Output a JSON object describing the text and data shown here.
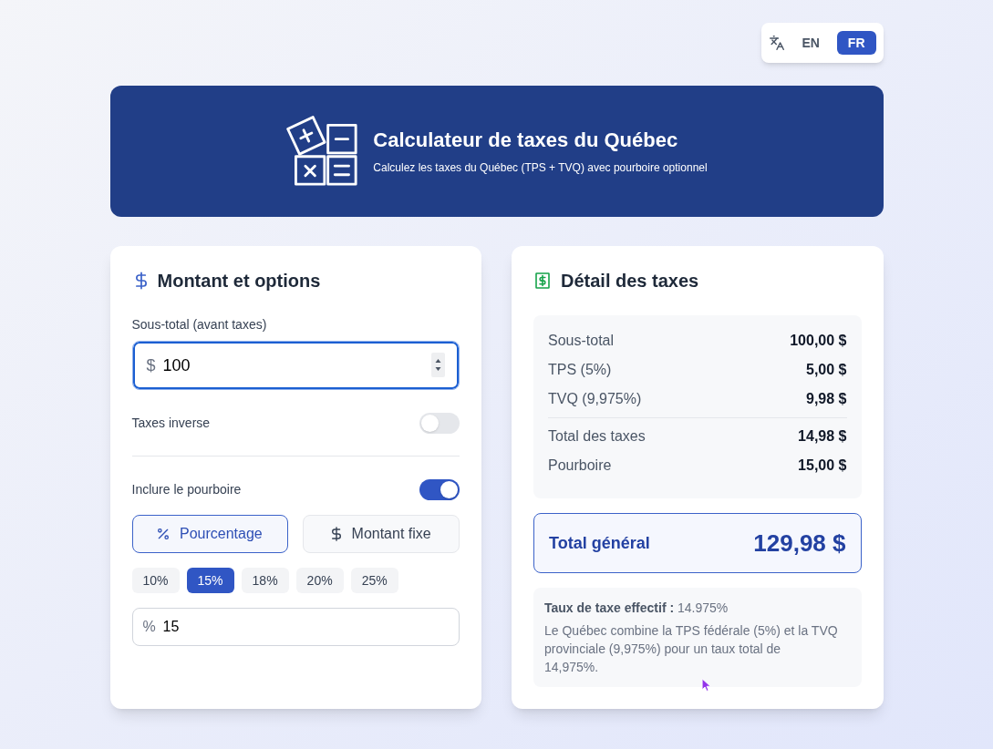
{
  "language_switcher": {
    "options": [
      {
        "label": "EN",
        "selected": false
      },
      {
        "label": "FR",
        "selected": true
      }
    ]
  },
  "header": {
    "title": "Calculateur de taxes du Québec",
    "subtitle": "Calculez les taxes du Québec (TPS + TVQ) avec pourboire optionnel"
  },
  "amount_card": {
    "title": "Montant et options",
    "subtotal_field": {
      "label": "Sous-total (avant taxes)",
      "prefix": "$",
      "value": "100",
      "focused": true
    },
    "reverse_tax": {
      "label": "Taxes inverse",
      "on": false
    },
    "tip": {
      "label": "Inclure le pourboire",
      "on": true
    },
    "tip_modes": [
      {
        "kind": "percent",
        "label": "Pourcentage",
        "selected": true
      },
      {
        "kind": "fixed",
        "label": "Montant fixe",
        "selected": false
      }
    ],
    "tip_presets": [
      {
        "label": "10%",
        "selected": false
      },
      {
        "label": "15%",
        "selected": true
      },
      {
        "label": "18%",
        "selected": false
      },
      {
        "label": "20%",
        "selected": false
      },
      {
        "label": "25%",
        "selected": false
      }
    ],
    "tip_field": {
      "prefix": "%",
      "value": "15"
    }
  },
  "breakdown_card": {
    "title": "Détail des taxes",
    "rows": [
      {
        "label": "Sous-total",
        "value": "100,00 $"
      },
      {
        "label": "TPS (5%)",
        "value": "5,00 $"
      },
      {
        "label": "TVQ (9,975%)",
        "value": "9,98 $"
      }
    ],
    "summary_rows": [
      {
        "label": "Total des taxes",
        "value": "14,98 $"
      },
      {
        "label": "Pourboire",
        "value": "15,00 $"
      }
    ],
    "grand_total": {
      "label": "Total général",
      "value": "129,98 $"
    },
    "note": {
      "effective_rate": "**Taux de taxe effectif :** 14.975%",
      "text": "Le Québec combine la TPS fédérale (5%) et la TVQ provinciale (9,975%) pour un taux total de 14,975%."
    }
  }
}
